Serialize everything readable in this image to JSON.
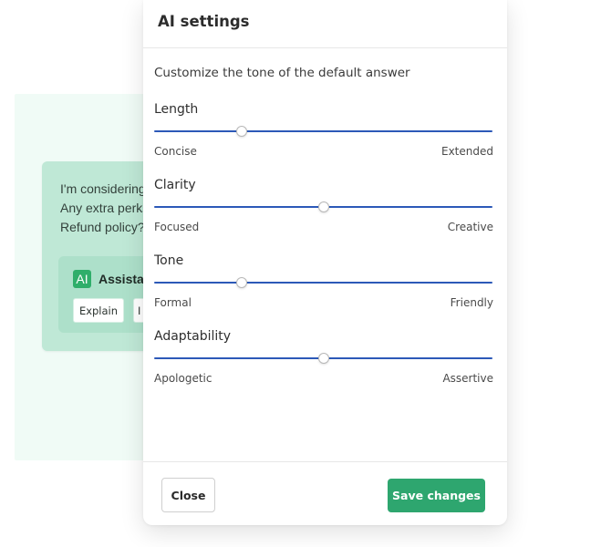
{
  "background": {
    "chat_lines": [
      "I'm considering",
      "Any extra perks",
      "Refund policy?"
    ],
    "assistant": {
      "badge": "AI",
      "label": "Assistan"
    },
    "chips": [
      "Explain",
      "I"
    ]
  },
  "modal": {
    "title": "AI settings",
    "subtitle": "Customize the tone of the default answer",
    "sliders": [
      {
        "title": "Length",
        "min_label": "Concise",
        "max_label": "Extended",
        "value": 0.26
      },
      {
        "title": "Clarity",
        "min_label": "Focused",
        "max_label": "Creative",
        "value": 0.5
      },
      {
        "title": "Tone",
        "min_label": "Formal",
        "max_label": "Friendly",
        "value": 0.26
      },
      {
        "title": "Adaptability",
        "min_label": "Apologetic",
        "max_label": "Assertive",
        "value": 0.5
      }
    ],
    "footer": {
      "close_label": "Close",
      "save_label": "Save changes"
    }
  },
  "colors": {
    "accent_green": "#2ea66f",
    "slider_track": "#2c59b8",
    "badge_green": "#2fae6a"
  }
}
